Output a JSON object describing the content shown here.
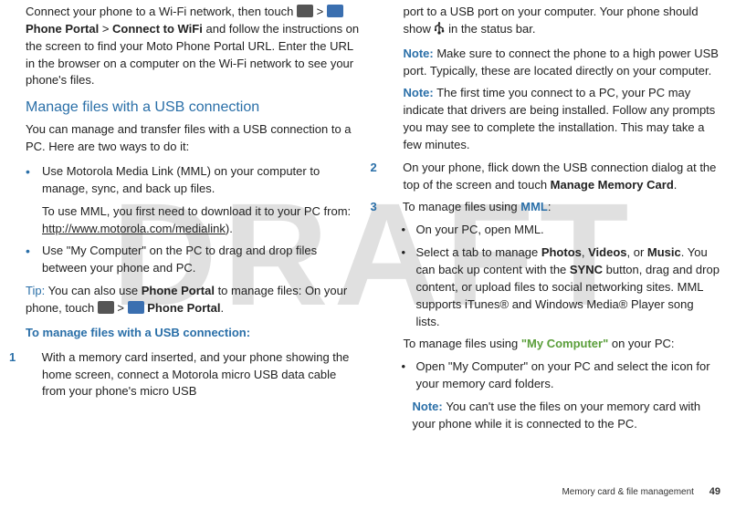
{
  "watermark": "DRAFT",
  "left": {
    "p1_part1": "Connect your phone to a Wi-Fi network, then touch ",
    "p1_gt1": " > ",
    "p1_b1": " Phone Portal",
    "p1_gt2": " > ",
    "p1_b2": " Connect to WiFi",
    "p1_part2": " and follow the instructions on the screen to find your Moto Phone Portal URL. Enter the URL in the browser on a computer on the Wi-Fi network to see your phone's files.",
    "heading1": "Manage files with a USB connection",
    "p2": "You can manage and transfer files with a USB connection to a PC. Here are two ways to do it:",
    "bullet1a": "Use Motorola Media Link (MML) on your computer to manage, sync, and back up files.",
    "bullet1b_pre": "To use MML, you first need to download it to your PC from: ",
    "bullet1b_link": "http://www.motorola.com/medialink",
    "bullet1b_post": ").",
    "bullet2": "Use \"My Computer\" on the PC to drag and drop files between your phone and PC.",
    "tip_label": "Tip:",
    "tip_part1": " You can also use ",
    "tip_b1": "Phone Portal",
    "tip_part2": " to manage files: On your phone, touch ",
    "tip_gt1": " > ",
    "tip_b2": " Phone Portal",
    "tip_end": ".",
    "subheading": "To manage files with a USB connection:",
    "step1_num": "1",
    "step1_text": "With a memory card inserted, and your phone showing the home screen, connect a Motorola micro USB data cable from your phone's micro USB "
  },
  "right": {
    "p1_part1": "port to a USB port on your computer. Your phone should show ",
    "p1_part2": " in the status bar.",
    "note1_label": "Note:",
    "note1_text": " Make sure to connect the phone to a high power USB port. Typically, these are located directly on your computer.",
    "note2_label": "Note:",
    "note2_text": " The first time you connect to a PC, your PC may indicate that drivers are being installed. Follow any prompts you may see to complete the installation. This may take a few minutes.",
    "step2_num": "2",
    "step2_part1": "On your phone, flick down the USB connection dialog at the top of the screen and touch ",
    "step2_b1": "Manage Memory Card",
    "step2_end": ".",
    "step3_num": "3",
    "step3_part1": "To manage files using ",
    "step3_mml": "MML",
    "step3_end": ":",
    "step3_sub1": "On your PC, open MML.",
    "step3_sub2_pre": "Select a tab to manage ",
    "step3_sub2_b1": "Photos",
    "step3_sub2_c1": ", ",
    "step3_sub2_b2": "Videos",
    "step3_sub2_c2": ", or ",
    "step3_sub2_b3": "Music",
    "step3_sub2_mid": ". You can back up content with the ",
    "step3_sub2_b4": "SYNC",
    "step3_sub2_post": " button, drag and drop content, or upload files to social networking sites. MML supports iTunes® and Windows Media® Player song lists.",
    "p_after_pre": "To manage files using ",
    "p_after_green": "\"My Computer\"",
    "p_after_post": " on your PC:",
    "sub_after1": "Open \"My Computer\" on your PC and select the icon for your memory card folders.",
    "inner_note_label": "Note: ",
    "inner_note_text": " You can't use the files on your memory card with your phone while it is connected to the PC."
  },
  "footer": {
    "section": "Memory card & file management",
    "page": "49"
  }
}
